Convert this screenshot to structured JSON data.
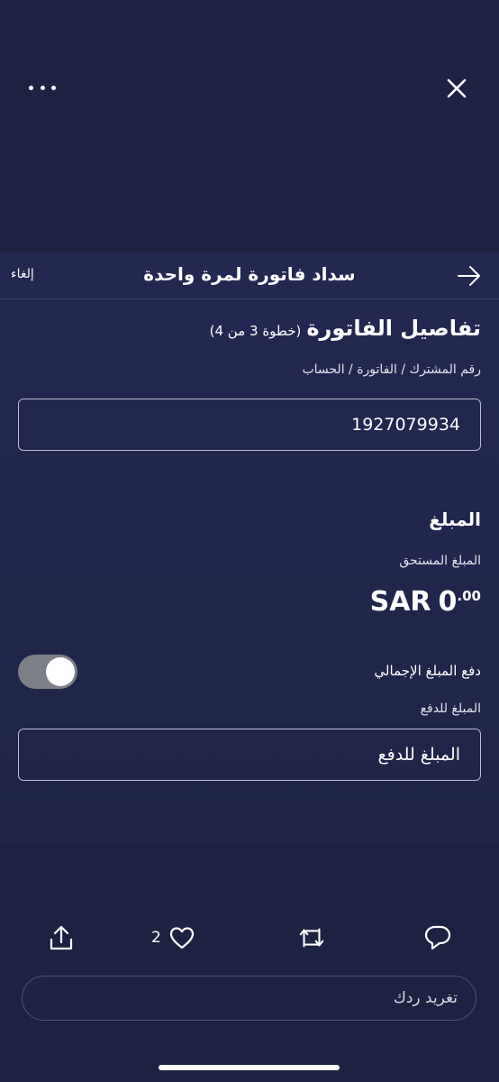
{
  "window": {
    "more_icon": "more-horizontal-icon",
    "close_icon": "close-icon"
  },
  "header": {
    "cancel_label": "إلغاء",
    "title": "سداد فاتورة لمرة واحدة",
    "back_icon": "arrow-right-icon"
  },
  "bill_details": {
    "title": "تفاصيل الفاتورة",
    "step": "(خطوة 3 من 4)",
    "account_label": "رقم المشترك / الفاتورة / الحساب",
    "account_value": "1927079934"
  },
  "amount": {
    "heading": "المبلغ",
    "due_label": "المبلغ المستحق",
    "currency": "SAR",
    "due_integer": "0",
    "due_decimal": ".00",
    "pay_total_label": "دفع المبلغ الإجمالي",
    "pay_total_enabled": true,
    "pay_amount_label": "المبلغ للدفع",
    "pay_amount_placeholder": "المبلغ للدفع"
  },
  "actions": {
    "like_count": "2",
    "icons": [
      "share-icon",
      "heart-icon",
      "retweet-icon",
      "reply-icon"
    ]
  },
  "reply": {
    "placeholder": "تغريد ردك"
  },
  "colors": {
    "background": "#1d2142",
    "card": "#222852",
    "toggle_track": "#7d7f87"
  }
}
